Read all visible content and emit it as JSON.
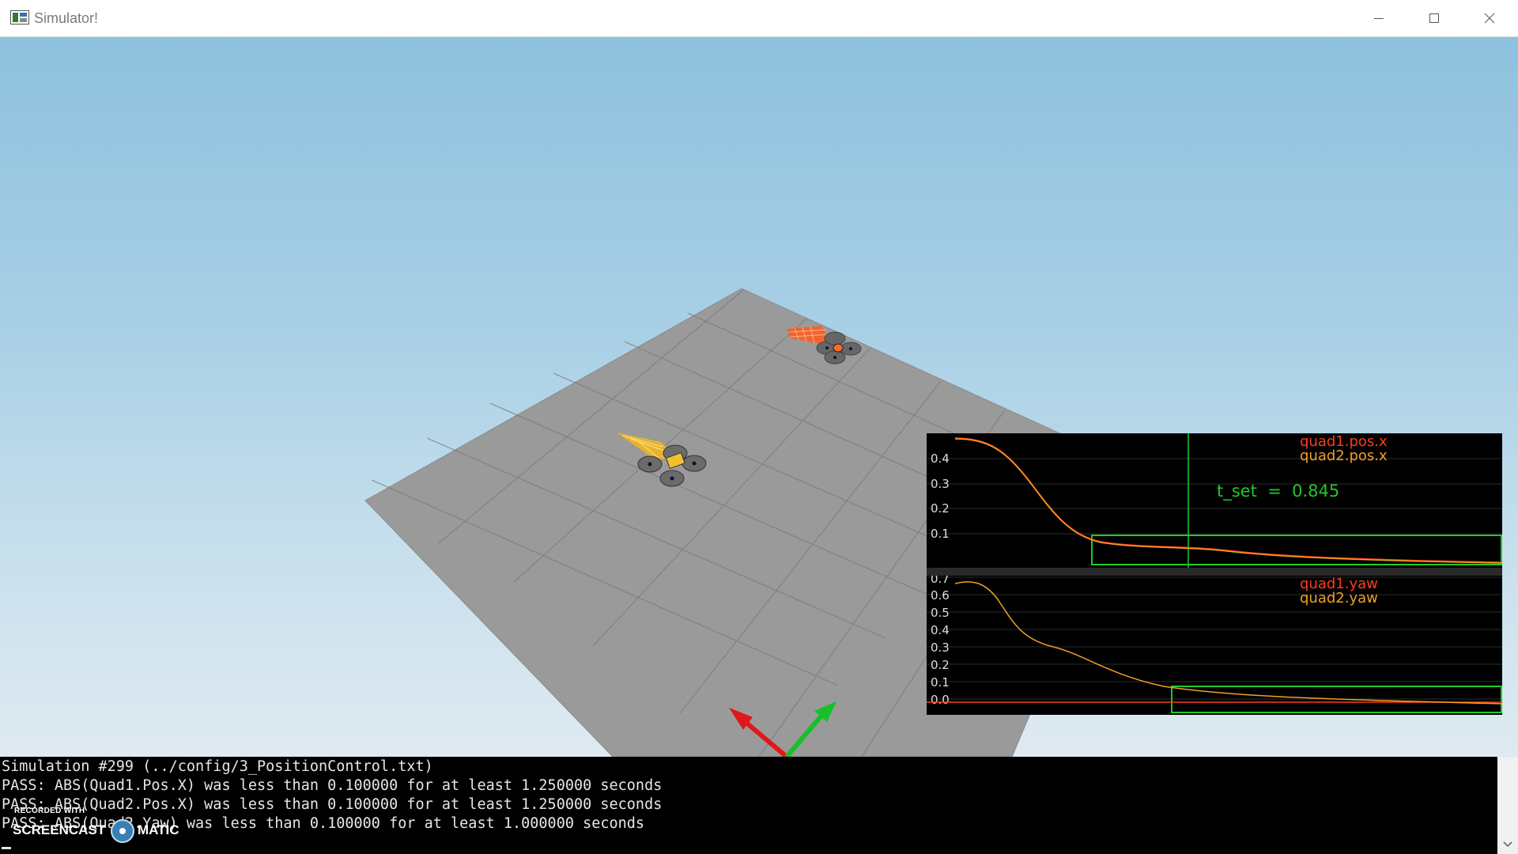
{
  "window": {
    "title": "Simulator!",
    "controls": {
      "minimize_icon": "minimize-icon",
      "maximize_icon": "maximize-icon",
      "close_icon": "close-icon"
    }
  },
  "plots": {
    "top": {
      "legend": [
        "quad1.pos.x",
        "quad2.pos.x"
      ],
      "legend_colors": [
        "#ff3b1f",
        "#f0a020"
      ],
      "annotation": "t_set  =  0.845",
      "annotation_color": "#1ecb2a",
      "yticks": [
        "0.4",
        "0.3",
        "0.2",
        "0.1"
      ]
    },
    "bottom": {
      "legend": [
        "quad1.yaw",
        "quad2.yaw"
      ],
      "legend_colors": [
        "#ff3b1f",
        "#f0a020"
      ],
      "yticks": [
        "0.7",
        "0.6",
        "0.5",
        "0.4",
        "0.3",
        "0.2",
        "0.1",
        "0.0"
      ]
    }
  },
  "console": {
    "lines": [
      "Simulation #299 (../config/3_PositionControl.txt)",
      "PASS: ABS(Quad1.Pos.X) was less than 0.100000 for at least 1.250000 seconds",
      "PASS: ABS(Quad2.Pos.X) was less than 0.100000 for at least 1.250000 seconds",
      "PASS: ABS(Quad2.Yaw) was less than 0.100000 for at least 1.000000 seconds"
    ]
  },
  "watermark": {
    "small": "RECORDED WITH",
    "left": "SCREENCAST",
    "right": "MATIC"
  },
  "colors": {
    "quad1": "#ff3b1f",
    "quad2": "#f0a020",
    "threshold": "#1ecb2a",
    "axis_x": "#e01818",
    "axis_y": "#18c028"
  }
}
